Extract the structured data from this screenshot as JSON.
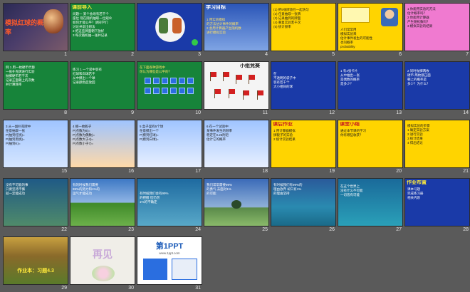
{
  "slides": [
    {
      "n": "1",
      "title": "模拟红球的概率",
      "body": []
    },
    {
      "n": "2",
      "title": "课前导入",
      "body": [
        "问题一 某个会场有若干个",
        "座位 现在随机抽取一位观众",
        "如何才能公平？请同学们",
        "讨论并说出想法",
        "2 把这些牌面朝下放好",
        "3 每次随机抽一张并记录"
      ]
    },
    {
      "n": "3",
      "title": "",
      "body": []
    },
    {
      "n": "4",
      "title": "学习目标",
      "body": [
        "1 用实验模拟",
        "的方法估计事件的概率",
        "2 会用计算器产生随机数",
        "进行模拟实验"
      ]
    },
    {
      "n": "5",
      "title": "",
      "body": [
        "(1) 把5张牌放在一起洗匀",
        "(2) 任意抽取一张牌",
        "(3) 记录抽到的牌面",
        "(4) 重复实验若干次",
        "(5) 统计频率"
      ]
    },
    {
      "n": "6",
      "title": "",
      "body": [
        "人们常常用",
        "模拟实验来",
        "估计事件发生的可能性",
        "也叫概率",
        "probability"
      ]
    },
    {
      "n": "7",
      "title": "",
      "body": [
        "1 你能用实验的方法",
        "估计概率吗？",
        "2 你能用计算器",
        "产生随机数吗？",
        "3 模拟实验的结果"
      ]
    },
    {
      "n": "8",
      "title": "",
      "body": [
        "例 1 用一枚硬币代替",
        "一张扑克牌进行实验",
        "抛掷硬币若干次",
        "记录正面朝上的次数",
        "并计算频率"
      ]
    },
    {
      "n": "9",
      "title": "",
      "body": [
        "练习 1 一个袋中装有",
        "红球和白球若干",
        "从中摸出一个球",
        "记录颜色后放回"
      ]
    },
    {
      "n": "10",
      "title": "",
      "body": [
        "在下面各种游戏中",
        "你认为哪些是公平的？"
      ]
    },
    {
      "n": "11",
      "title": "小组竞赛",
      "body": []
    },
    {
      "n": "12",
      "title": "",
      "body": [
        "在",
        "不透明的袋子中",
        "装有若干个",
        "大小相同的球"
      ]
    },
    {
      "n": "13",
      "title": "",
      "body": [
        "1 有4张卡片",
        "从中抽出一张",
        "是偶数的概率",
        "是多少？"
      ]
    },
    {
      "n": "14",
      "title": "",
      "body": [
        "2 同时抛掷两枚",
        "硬币 两枚都正面",
        "朝上的概率是",
        "多少？为什么？"
      ]
    },
    {
      "n": "15",
      "title": "",
      "body": [
        "3 从一副扑克牌中",
        "任意抽取一张",
        "P(抽到红桃)=",
        "P(抽到黑桃)=",
        "P(抽到K)="
      ]
    },
    {
      "n": "16",
      "title": "",
      "body": [
        "4 掷一枚骰子",
        "P(点数为6)=",
        "P(点数为偶数)=",
        "P(点数大于4)=",
        "P(点数小于7)="
      ]
    },
    {
      "n": "17",
      "title": "",
      "body": [
        "5 盒子里有5个球",
        "任意摸出一个",
        "P(摸到红球)=",
        "P(摸到白球)="
      ]
    },
    {
      "n": "18",
      "title": "",
      "body": [
        "6 在一个试验中",
        "某事件发生的频率",
        "稳定在0.25附近",
        "估计它的概率"
      ]
    },
    {
      "n": "19",
      "title": "课后作业",
      "body": [
        "1 用计算器模拟",
        "掷骰子的实验",
        "2 统计实验结果"
      ]
    },
    {
      "n": "20",
      "title": "课堂小结",
      "body": [
        "通过本节课的学习",
        "你有哪些收获？"
      ]
    },
    {
      "n": "21",
      "title": "",
      "body": [
        "模拟实验的步骤",
        "1 确定实验方案",
        "2 进行实验",
        "3 统计结果",
        "4 得出结论"
      ]
    },
    {
      "n": "22",
      "title": "",
      "body": [
        "没有不可能的事",
        "只要坚持不懈",
        "就一定能成功"
      ]
    },
    {
      "n": "23",
      "title": "",
      "body": [
        "有的时候我们需要",
        "99%的努力和1%的",
        "运气才能成功"
      ]
    },
    {
      "n": "24",
      "title": "",
      "body": [
        "有时候我们会有99%",
        "的把握 但仍然",
        "1%的不确定"
      ]
    },
    {
      "n": "25",
      "title": "",
      "body": [
        "我们常常需要99%",
        "的勇气 去面对1%",
        "的可能"
      ]
    },
    {
      "n": "26",
      "title": "",
      "body": [
        "有时候我们有99%的",
        "理由放弃 却只有1%",
        "的理由坚持"
      ]
    },
    {
      "n": "27",
      "title": "",
      "body": [
        "在这个世界上",
        "没有什么不可能",
        "一切皆有可能"
      ]
    },
    {
      "n": "28",
      "title": "作业布置",
      "body": [
        "课本习题",
        "完成练习册",
        "相关内容"
      ]
    },
    {
      "n": "29",
      "title": "",
      "body": [
        "作业本：习题4.3"
      ]
    },
    {
      "n": "30",
      "title": "",
      "body": [
        "再见"
      ]
    },
    {
      "n": "31",
      "title": "第1PPT",
      "body": [
        "www.1ppt.com"
      ]
    }
  ]
}
